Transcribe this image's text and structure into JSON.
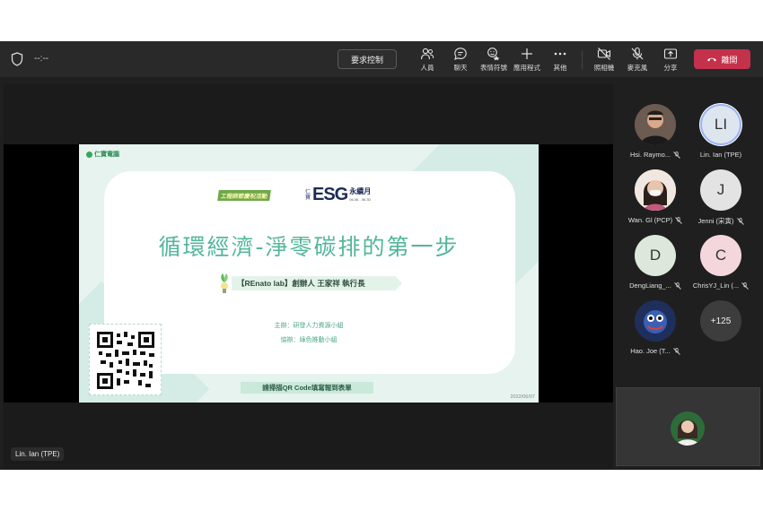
{
  "toolbar": {
    "timer": "--:--",
    "request_control": "要求控制",
    "people": "人員",
    "chat": "聊天",
    "reactions": "表情符號",
    "apps": "應用程式",
    "more": "其他",
    "camera": "照相機",
    "mic": "麥克風",
    "share": "分享",
    "leave": "離開",
    "leave_color": "#c4314b"
  },
  "slide": {
    "logo": "仁寶電腦",
    "badge": "工程師節慶祝活動",
    "esg_prefix": "仁寶",
    "esg": "ESG",
    "esg_suffix": "永續月",
    "esg_dates": "06.06 - 06.30",
    "title": "循環經濟-淨零碳排的第一步",
    "speaker": "【REnato lab】創辦人 王家祥 執行長",
    "host": "主辦：研發人力資源小組",
    "cohost": "協辦：綠色推動小組",
    "qr_prompt": "請掃描QR Code填寫報到表單",
    "date": "2022/06/07",
    "accent": "#52b69a"
  },
  "presenter": {
    "name": "Lin. Ian (TPE)"
  },
  "participants": [
    {
      "name": "Hsi. Raymo...",
      "initials": ""
    },
    {
      "name": "Lin. Ian (TPE)",
      "initials": "LI"
    },
    {
      "name": "Wan. Gl (PCP)",
      "initials": ""
    },
    {
      "name": "Jenni (宋寅)",
      "initials": "J"
    },
    {
      "name": "DengLiang_...",
      "initials": "D"
    },
    {
      "name": "ChrisYJ_Lin (...",
      "initials": "C"
    },
    {
      "name": "Hao. Joe (T...",
      "initials": ""
    },
    {
      "name": "",
      "initials": "+125"
    }
  ]
}
